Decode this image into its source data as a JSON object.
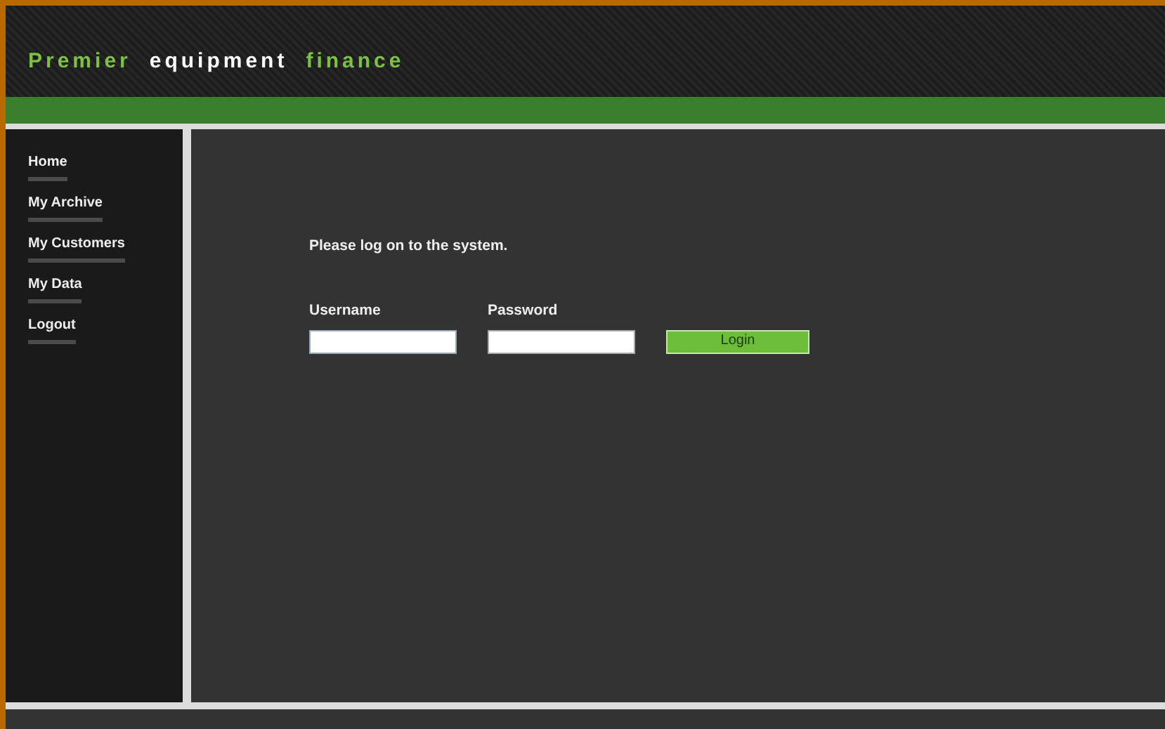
{
  "logo": {
    "words": [
      {
        "text": "Premier",
        "color": "#7dc142"
      },
      {
        "text": "equipment",
        "color": "#ffffff"
      },
      {
        "text": "finance",
        "color": "#7dc142"
      }
    ]
  },
  "sidebar": {
    "items": [
      {
        "label": "Home"
      },
      {
        "label": "My Archive"
      },
      {
        "label": "My Customers"
      },
      {
        "label": "My Data"
      },
      {
        "label": "Logout"
      }
    ]
  },
  "login": {
    "message": "Please log on to the system.",
    "username_label": "Username",
    "password_label": "Password",
    "button": "Login"
  }
}
